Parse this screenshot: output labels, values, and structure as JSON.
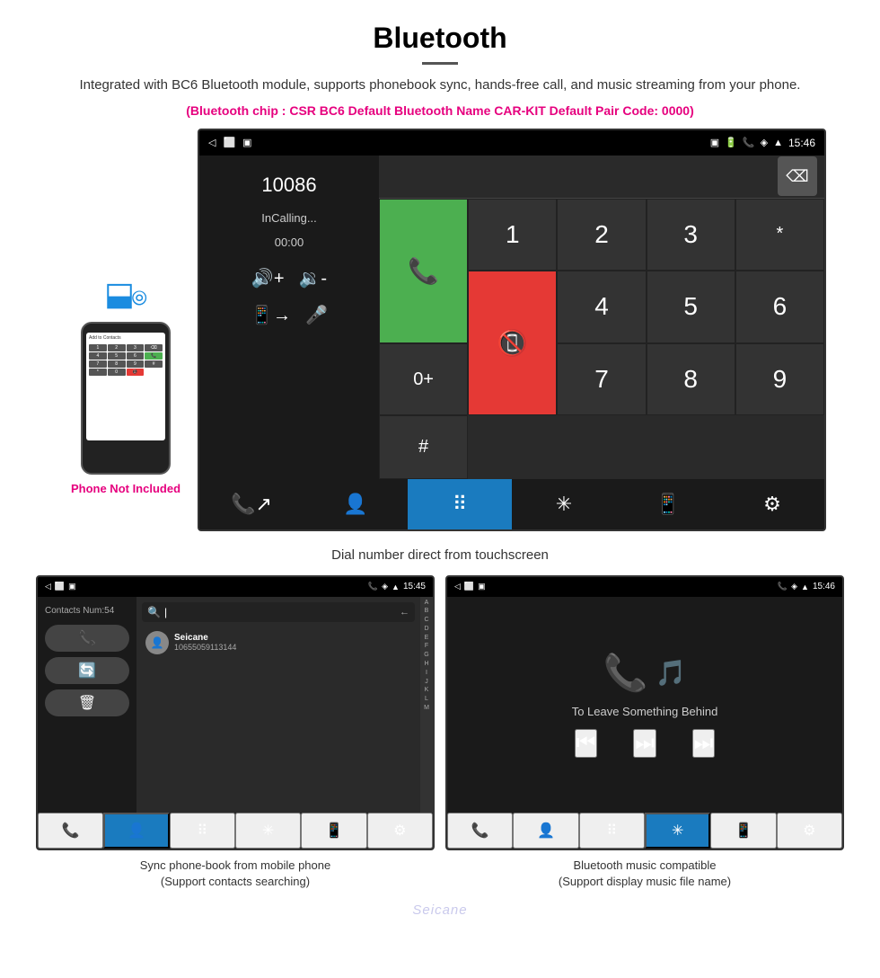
{
  "header": {
    "title": "Bluetooth",
    "description": "Integrated with BC6 Bluetooth module, supports phonebook sync, hands-free call, and music streaming from your phone.",
    "specs": "(Bluetooth chip : CSR BC6    Default Bluetooth Name CAR-KIT    Default Pair Code: 0000)",
    "phone_not_included": "Phone Not Included"
  },
  "main_screen": {
    "statusbar": {
      "time": "15:46",
      "icons": [
        "phone",
        "location",
        "wifi"
      ]
    },
    "dial_number": "10086",
    "dial_status": "InCalling...",
    "dial_time": "00:00",
    "numpad": [
      "1",
      "2",
      "3",
      "*",
      "4",
      "5",
      "6",
      "0+",
      "7",
      "8",
      "9",
      "#"
    ],
    "caption": "Dial number direct from touchscreen"
  },
  "contacts_screen": {
    "statusbar_time": "15:45",
    "contacts_num": "Contacts Num:54",
    "contact_name": "Seicane",
    "contact_number": "10655059113144",
    "alphabet": [
      "A",
      "B",
      "C",
      "D",
      "E",
      "F",
      "G",
      "H",
      "I",
      "J",
      "K",
      "L",
      "M"
    ],
    "search_placeholder": "Search"
  },
  "music_screen": {
    "statusbar_time": "15:46",
    "song_title": "To Leave Something Behind",
    "caption1": "Sync phone-book from mobile phone",
    "caption1_sub": "(Support contacts searching)",
    "caption2": "Bluetooth music compatible",
    "caption2_sub": "(Support display music file name)"
  },
  "watermark": "Seicane",
  "nav_icons": {
    "call_transfer": "📞",
    "contacts": "👤",
    "numpad": "⠿",
    "bluetooth": "✳",
    "phone_out": "📱",
    "settings": "⚙"
  }
}
